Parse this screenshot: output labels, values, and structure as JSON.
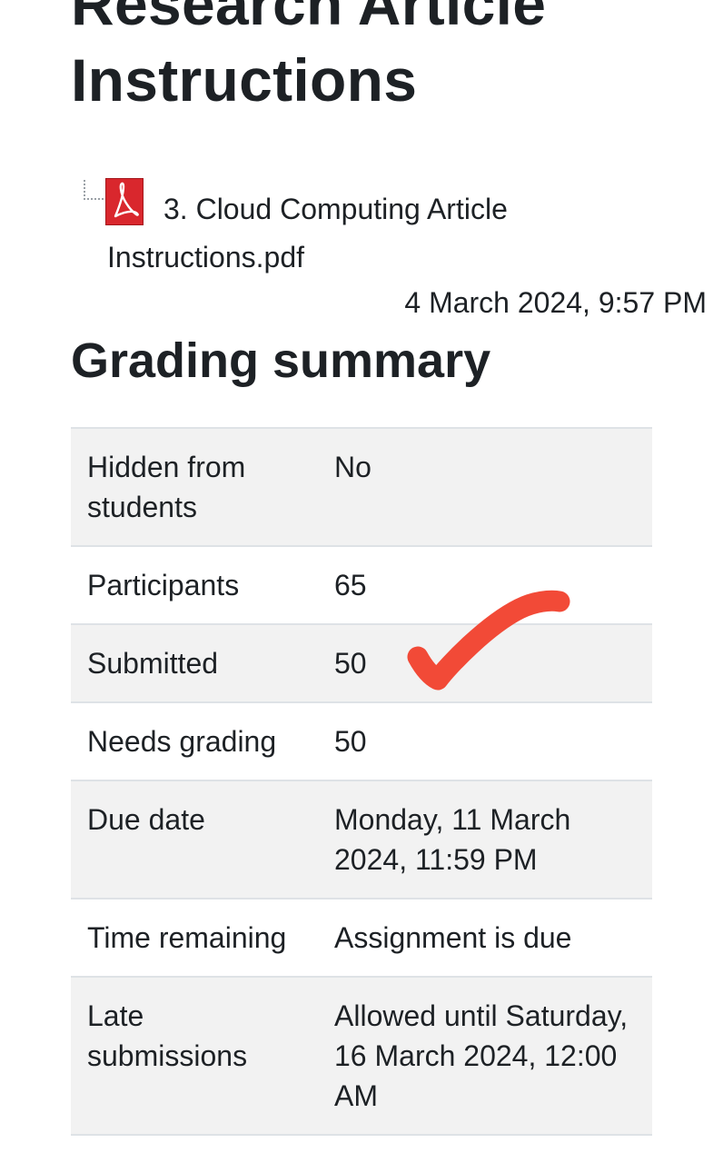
{
  "assignment": {
    "title": "Research Article Instructions"
  },
  "attachment": {
    "icon": "pdf-icon",
    "file_name": "3. Cloud Computing Article Instructions.pdf",
    "date": "4 March 2024, 9:57 PM"
  },
  "grading_summary": {
    "heading": "Grading summary",
    "rows": [
      {
        "label": "Hidden from students",
        "value": "No"
      },
      {
        "label": "Participants",
        "value": "65"
      },
      {
        "label": "Submitted",
        "value": "50"
      },
      {
        "label": "Needs grading",
        "value": "50"
      },
      {
        "label": "Due date",
        "value": "Monday, 11 March 2024, 11:59 PM"
      },
      {
        "label": "Time remaining",
        "value": "Assignment is due"
      },
      {
        "label": "Late submissions",
        "value": "Allowed until Saturday, 16 March 2024, 12:00 AM"
      }
    ]
  },
  "colors": {
    "text": "#1d2125",
    "row_stripe": "#f2f2f2",
    "border": "#dee2e6",
    "pdf_red": "#d9272d",
    "annotation_mark": "#f24a37"
  }
}
